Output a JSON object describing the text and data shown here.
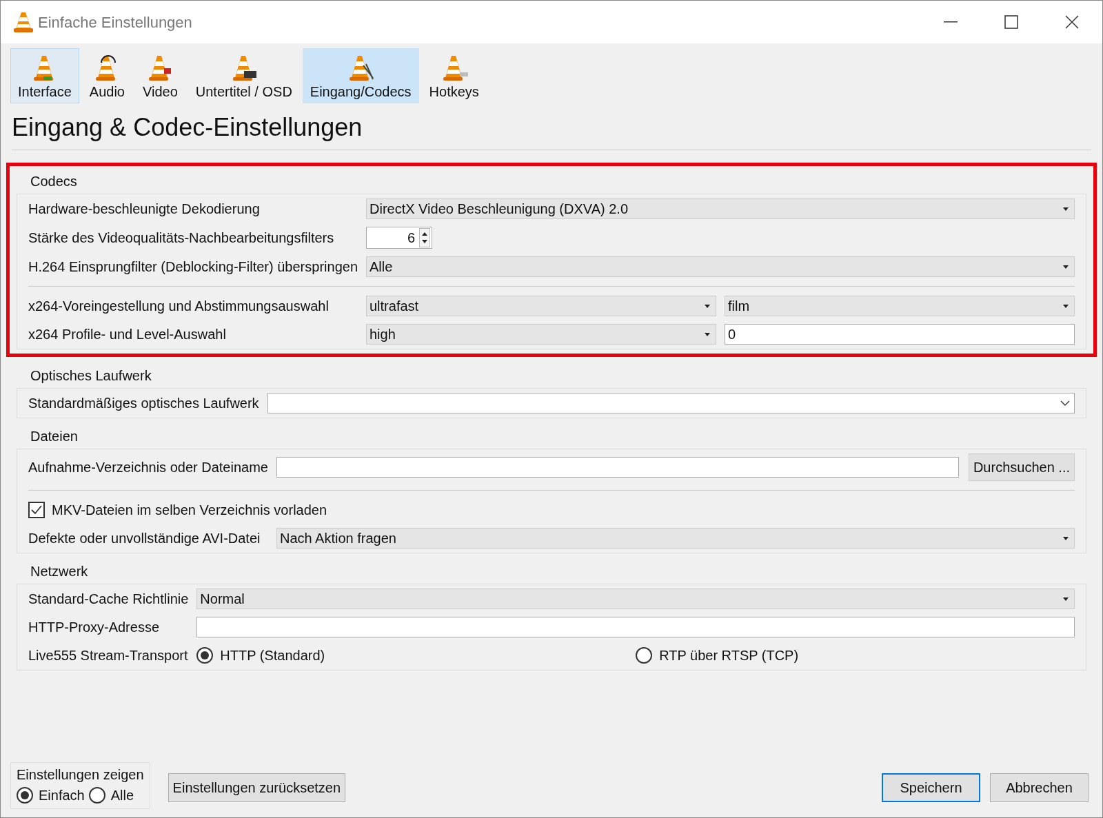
{
  "window": {
    "title": "Einfache Einstellungen"
  },
  "tabs": [
    {
      "label": "Interface",
      "selected": false,
      "hover": true
    },
    {
      "label": "Audio",
      "selected": false,
      "hover": false
    },
    {
      "label": "Video",
      "selected": false,
      "hover": false
    },
    {
      "label": "Untertitel / OSD",
      "selected": false,
      "hover": false
    },
    {
      "label": "Eingang/Codecs",
      "selected": true,
      "hover": false
    },
    {
      "label": "Hotkeys",
      "selected": false,
      "hover": false
    }
  ],
  "heading": "Eingang & Codec-Einstellungen",
  "sections": [
    {
      "title": "Codecs",
      "highlighted": true,
      "rows": [
        {
          "kind": "select",
          "label": "Hardware-beschleunigte Dekodierung",
          "value": "DirectX Video Beschleunigung (DXVA) 2.0"
        },
        {
          "kind": "spin",
          "label": "Stärke des Videoqualitäts-Nachbearbeitungsfilters",
          "value": "6"
        },
        {
          "kind": "select",
          "label": "H.264 Einsprungfilter (Deblocking-Filter) überspringen",
          "value": "Alle"
        },
        {
          "kind": "divider"
        },
        {
          "kind": "select_pair",
          "label": "x264-Voreingestellung und Abstimmungsauswahl",
          "value": "ultrafast",
          "value2": "film"
        },
        {
          "kind": "select_text",
          "label": "x264 Profile- und Level-Auswahl",
          "value": "high",
          "value2": "0"
        }
      ]
    },
    {
      "title": "Optisches Laufwerk",
      "highlighted": false,
      "rows": [
        {
          "kind": "dropdown",
          "label": "Standardmäßiges optisches Laufwerk"
        }
      ]
    },
    {
      "title": "Dateien",
      "highlighted": false,
      "rows": [
        {
          "kind": "browse",
          "label": "Aufnahme-Verzeichnis oder Dateiname",
          "button": "Durchsuchen ..."
        },
        {
          "kind": "divider"
        },
        {
          "kind": "checkbox",
          "label": "MKV-Dateien im selben Verzeichnis vorladen",
          "checked": true
        },
        {
          "kind": "select",
          "label": "Defekte oder unvollständige AVI-Datei",
          "value": "Nach Aktion fragen"
        }
      ]
    },
    {
      "title": "Netzwerk",
      "highlighted": false,
      "rows": [
        {
          "kind": "select",
          "label": "Standard-Cache Richtlinie",
          "value": "Normal"
        },
        {
          "kind": "text",
          "label": "HTTP-Proxy-Adresse"
        },
        {
          "kind": "radio",
          "label": "Live555 Stream-Transport",
          "options": [
            {
              "label": "HTTP (Standard)",
              "selected": true
            },
            {
              "label": "RTP über RTSP (TCP)",
              "selected": false
            }
          ]
        }
      ]
    }
  ],
  "footer": {
    "group_title": "Einstellungen zeigen",
    "modes": [
      {
        "label": "Einfach",
        "selected": true
      },
      {
        "label": "Alle",
        "selected": false
      }
    ],
    "reset": "Einstellungen zurücksetzen",
    "save": "Speichern",
    "cancel": "Abbrechen"
  }
}
